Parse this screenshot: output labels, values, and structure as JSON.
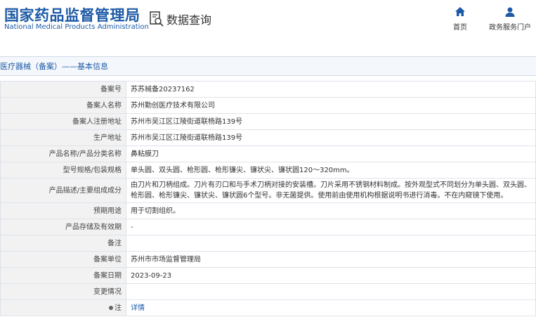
{
  "header": {
    "logo_cn": "国家药品监督管理局",
    "logo_en": "National Medical Products Administration",
    "query_label": "数据查询",
    "nav": {
      "home": "首页",
      "portal": "政务服务门户"
    }
  },
  "breadcrumb": "医疗器械（备案）——基本信息",
  "fields": [
    {
      "label": "备案号",
      "value": "苏苏械备20237162"
    },
    {
      "label": "备案人名称",
      "value": "苏州勤创医疗技术有限公司"
    },
    {
      "label": "备案人注册地址",
      "value": "苏州市吴江区江陵街道联杨路139号"
    },
    {
      "label": "生产地址",
      "value": "苏州市吴江区江陵街道联杨路139号"
    },
    {
      "label": "产品名称/产品分类名称",
      "value": "鼻粘膜刀"
    },
    {
      "label": "型号规格/包装规格",
      "value": "单头圆、双头圆、枪形圆、枪形镰尖、镰状尖、镰状圆120～320mm。"
    },
    {
      "label": "产品描述/主要组成成分",
      "value": "由刀片和刀柄组成。刀片有刃口和与手术刀柄对接的安装槽。刀片采用不锈钢材料制成。按外观型式不同划分为单头圆、双头圆、枪形圆、枪形镰尖、镰状尖、镰状圆6个型号。非无菌提供。使用前由使用机构根据说明书进行消毒。不在内窥镜下使用。"
    },
    {
      "label": "预期用途",
      "value": "用于切割组织。"
    },
    {
      "label": "产品存储及有效期",
      "value": "-"
    },
    {
      "label": "备注",
      "value": ""
    },
    {
      "label": "备案单位",
      "value": "苏州市市场监督管理局"
    },
    {
      "label": "备案日期",
      "value": "2023-09-23"
    },
    {
      "label": "变更情况",
      "value": ""
    },
    {
      "label": "注",
      "value": "详情",
      "icon": "bullet-icon"
    }
  ],
  "colors": {
    "brand": "#1d5aa6",
    "label_bg": "#f2f2f2",
    "border": "#dde3ea"
  }
}
